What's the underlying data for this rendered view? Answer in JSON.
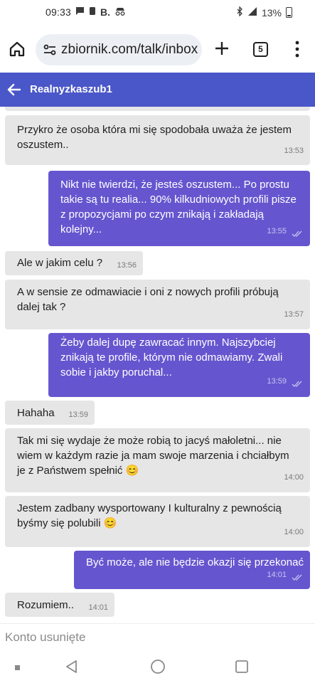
{
  "status_bar": {
    "time": "09:33",
    "left_icons": [
      "chat-bubble-icon",
      "notification-icon",
      "B."
    ],
    "battery": "13%"
  },
  "browser": {
    "url": "zbiornik.com/talk/inbox",
    "tab_count": "5"
  },
  "conversation": {
    "title": "Realnyzkaszub1"
  },
  "messages": [
    {
      "dir": "in",
      "text": "Przykro że osoba która mi się spodobała uważa że jestem oszustem..",
      "time": "13:53"
    },
    {
      "dir": "out",
      "text": "Nikt nie twierdzi, że jesteś oszustem... Po prostu takie są tu realia... 90% kilkudniowych profili pisze z propozycjami po czym znikają i zakładają kolejny...",
      "time": "13:55"
    },
    {
      "dir": "in",
      "text": "Ale w jakim celu ?",
      "time": "13:56"
    },
    {
      "dir": "in",
      "text": "A w sensie ze odmawiacie i oni z nowych profili próbują dalej tak ?",
      "time": "13:57"
    },
    {
      "dir": "out",
      "text": "Żeby dalej dupę zawracać innym. Najszybciej znikają te profile, którym nie odmawiamy. Zwali sobie i jakby poruchal...",
      "time": "13:59"
    },
    {
      "dir": "in",
      "text": "Hahaha",
      "time": "13:59"
    },
    {
      "dir": "in",
      "text": "Tak mi się wydaje że może robią to jacyś małoletni... nie wiem w każdym razie ja mam swoje marzenia i chciałbym je z Państwem spełnić 😊",
      "time": "14:00"
    },
    {
      "dir": "in",
      "text": "Jestem zadbany wysportowany I kulturalny z pewnością byśmy się polubili 😊",
      "time": "14:00"
    },
    {
      "dir": "out",
      "text": "Być może, ale nie będzie okazji się przekonać",
      "time": "14:01"
    },
    {
      "dir": "in",
      "text": "Rozumiem..",
      "time": "14:01"
    }
  ],
  "footer": {
    "deleted_notice": "Konto usunięte"
  },
  "colors": {
    "header": "#4a57c8",
    "outgoing": "#6556cf",
    "incoming": "#e6e6e6"
  }
}
